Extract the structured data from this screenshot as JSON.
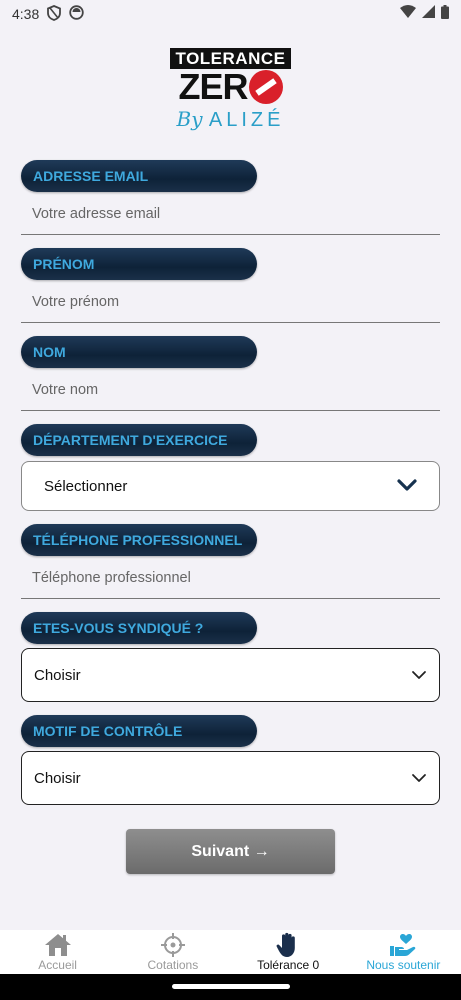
{
  "status_bar": {
    "time": "4:38"
  },
  "logo": {
    "line1": "TOLERANCE",
    "line2": "ZER",
    "by": "By",
    "brand": "ALIZÉ"
  },
  "form": {
    "email": {
      "label": "ADRESSE EMAIL",
      "placeholder": "Votre adresse email"
    },
    "firstname": {
      "label": "PRÉNOM",
      "placeholder": "Votre prénom"
    },
    "lastname": {
      "label": "NOM",
      "placeholder": "Votre nom"
    },
    "department": {
      "label": "DÉPARTEMENT D'EXERCICE",
      "value": "Sélectionner"
    },
    "phone": {
      "label": "TÉLÉPHONE PROFESSIONNEL",
      "placeholder": "Téléphone professionnel"
    },
    "union": {
      "label": "ETES-VOUS SYNDIQUÉ ?",
      "value": "Choisir"
    },
    "reason": {
      "label": "MOTIF DE CONTRÔLE",
      "value": "Choisir"
    },
    "next_label": "Suivant →"
  },
  "bottom_nav": {
    "items": [
      {
        "label": "Accueil",
        "icon": "home-icon"
      },
      {
        "label": "Cotations",
        "icon": "crosshair-icon"
      },
      {
        "label": "Tolérance 0",
        "icon": "hand-stop-icon"
      },
      {
        "label": "Nous soutenir",
        "icon": "heart-hand-icon"
      }
    ],
    "active_index": 2
  },
  "colors": {
    "accent": "#3fa9de",
    "pill_dark": "#0e2238",
    "logo_red": "#d9202a",
    "support_blue": "#2aa6d6"
  }
}
